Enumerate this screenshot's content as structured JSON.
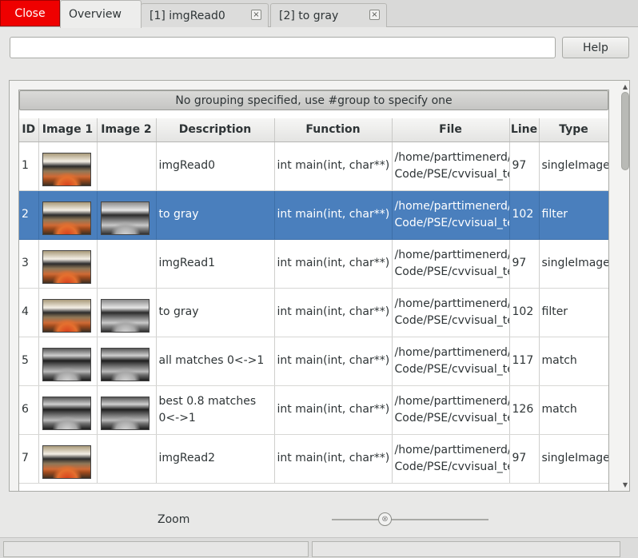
{
  "tabbar": {
    "close_label": "Close",
    "tabs": [
      {
        "label": "Overview",
        "closable": false,
        "active": true
      },
      {
        "label": "[1] imgRead0",
        "closable": true,
        "active": false
      },
      {
        "label": "[2] to gray",
        "closable": true,
        "active": false
      }
    ],
    "close_tab_glyph": "×"
  },
  "toolbar": {
    "search_value": "",
    "help_label": "Help"
  },
  "table": {
    "group_header": "No grouping specified, use #group to specify one",
    "columns": [
      "ID",
      "Image 1",
      "Image 2",
      "Description",
      "Function",
      "File",
      "Line",
      "Type"
    ],
    "rows": [
      {
        "id": "1",
        "image1": "color",
        "image2": "",
        "description": "imgRead0",
        "function": "int main(int, char**)",
        "file1": "/home/parttimenerd/",
        "file2": "Code/PSE/cvvisual_te",
        "line": "97",
        "type": "singleImage",
        "selected": false
      },
      {
        "id": "2",
        "image1": "color",
        "image2": "gray",
        "description": "to gray",
        "function": "int main(int, char**)",
        "file1": "/home/parttimenerd/",
        "file2": "Code/PSE/cvvisual_te",
        "line": "102",
        "type": "filter",
        "selected": true
      },
      {
        "id": "3",
        "image1": "color",
        "image2": "",
        "description": "imgRead1",
        "function": "int main(int, char**)",
        "file1": "/home/parttimenerd/",
        "file2": "Code/PSE/cvvisual_te",
        "line": "97",
        "type": "singleImage",
        "selected": false
      },
      {
        "id": "4",
        "image1": "color",
        "image2": "gray",
        "description": "to gray",
        "function": "int main(int, char**)",
        "file1": "/home/parttimenerd/",
        "file2": "Code/PSE/cvvisual_te",
        "line": "102",
        "type": "filter",
        "selected": false
      },
      {
        "id": "5",
        "image1": "dark",
        "image2": "dark",
        "description": "all matches 0<->1",
        "function": "int main(int, char**)",
        "file1": "/home/parttimenerd/",
        "file2": "Code/PSE/cvvisual_te",
        "line": "117",
        "type": "match",
        "selected": false
      },
      {
        "id": "6",
        "image1": "dark",
        "image2": "dark",
        "description": "best 0.8 matches 0<->1",
        "function": "int main(int, char**)",
        "file1": "/home/parttimenerd/",
        "file2": "Code/PSE/cvvisual_te",
        "line": "126",
        "type": "match",
        "selected": false
      },
      {
        "id": "7",
        "image1": "color",
        "image2": "",
        "description": "imgRead2",
        "function": "int main(int, char**)",
        "file1": "/home/parttimenerd/",
        "file2": "Code/PSE/cvvisual_te",
        "line": "97",
        "type": "singleImage",
        "selected": false
      }
    ]
  },
  "scrollbar": {
    "up_glyph": "▲",
    "down_glyph": "▼",
    "position": 0
  },
  "zoom": {
    "label": "Zoom",
    "value": 0.3,
    "handle_glyph": "⊗"
  },
  "statusbar": {
    "fields": [
      "",
      ""
    ]
  }
}
